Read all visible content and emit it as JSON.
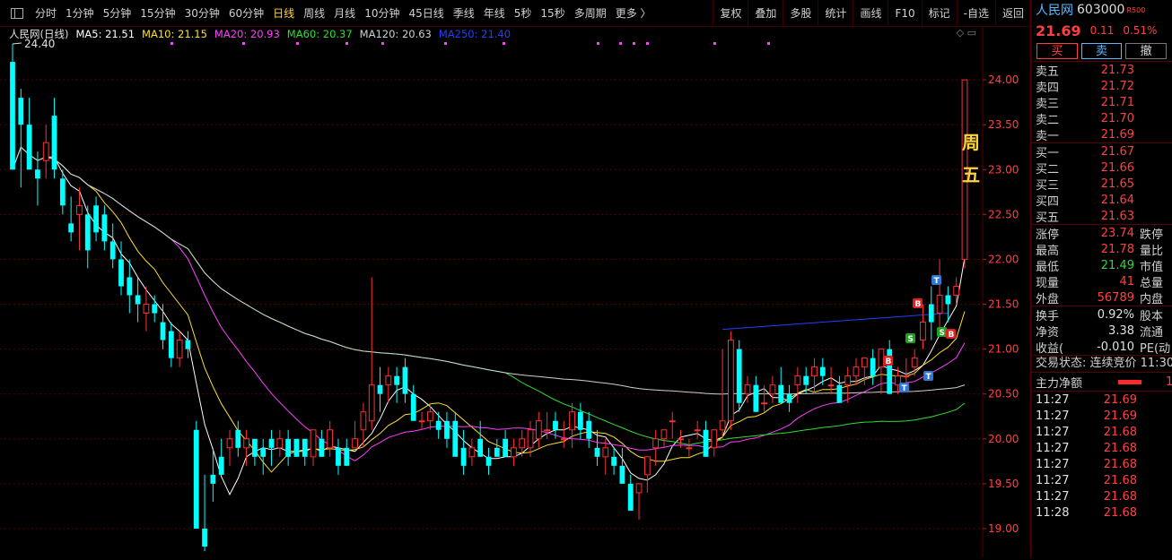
{
  "toolbar": {
    "periods": [
      "分时",
      "1分钟",
      "5分钟",
      "15分钟",
      "30分钟",
      "60分钟",
      "日线",
      "周线",
      "月线",
      "10分钟",
      "45日线",
      "季线",
      "年线",
      "5秒",
      "15秒",
      "多周期",
      "更多 〉"
    ],
    "active_period": "日线",
    "tools": [
      "复权",
      "叠加",
      "多股",
      "统计",
      "画线",
      "F10",
      "标记",
      "-自选",
      "返回"
    ]
  },
  "chart": {
    "series_name": "人民网(日线)",
    "ma": [
      {
        "label": "MA5: 21.51",
        "color": "#ffffff"
      },
      {
        "label": "MA10: 21.15",
        "color": "#ffe030"
      },
      {
        "label": "MA20: 20.93",
        "color": "#ff40ff"
      },
      {
        "label": "MA60: 20.37",
        "color": "#30e030"
      },
      {
        "label": "MA120: 20.63",
        "color": "#d0d0d0"
      },
      {
        "label": "MA250: 21.40",
        "color": "#2040ff"
      }
    ],
    "high_label": "24.40",
    "annotation": [
      "周",
      "五"
    ],
    "y_ticks": [
      "24.00",
      "23.50",
      "23.00",
      "22.50",
      "22.00",
      "21.50",
      "21.00",
      "20.50",
      "20.00",
      "19.50",
      "19.00"
    ],
    "signals": [
      "B",
      "B",
      "S",
      "S",
      "B",
      "T",
      "T",
      "T"
    ],
    "colors": {
      "up": "#ff3030",
      "down": "#00ffff"
    }
  },
  "chart_data": {
    "type": "candlestick",
    "ylim": [
      18.75,
      24.45
    ],
    "ohlc": [
      [
        24.2,
        24.4,
        23.0,
        23.0
      ],
      [
        23.8,
        23.9,
        22.8,
        23.5
      ],
      [
        23.5,
        23.8,
        23.0,
        23.0
      ],
      [
        23.0,
        23.2,
        22.6,
        22.9
      ],
      [
        23.1,
        23.5,
        22.9,
        23.3
      ],
      [
        23.6,
        23.8,
        22.9,
        23.0
      ],
      [
        22.9,
        23.0,
        22.5,
        22.6
      ],
      [
        22.4,
        22.7,
        22.2,
        22.3
      ],
      [
        22.5,
        22.8,
        22.1,
        22.6
      ],
      [
        22.5,
        22.6,
        21.9,
        22.1
      ],
      [
        22.6,
        22.7,
        22.2,
        22.3
      ],
      [
        22.5,
        22.6,
        22.1,
        22.2
      ],
      [
        22.2,
        22.4,
        21.9,
        22.0
      ],
      [
        22.0,
        22.2,
        21.6,
        21.7
      ],
      [
        21.8,
        22.0,
        21.4,
        21.6
      ],
      [
        21.6,
        21.8,
        21.3,
        21.5
      ],
      [
        21.4,
        21.7,
        21.2,
        21.5
      ],
      [
        21.5,
        21.6,
        21.3,
        21.4
      ],
      [
        21.3,
        21.5,
        21.0,
        21.1
      ],
      [
        21.2,
        21.3,
        20.8,
        20.9
      ],
      [
        20.9,
        21.2,
        20.8,
        21.1
      ],
      [
        21.1,
        21.2,
        20.9,
        21.0
      ],
      [
        20.1,
        20.2,
        19.0,
        19.0
      ],
      [
        19.0,
        19.6,
        18.75,
        18.8
      ],
      [
        19.6,
        19.9,
        19.3,
        19.5
      ],
      [
        19.8,
        20.0,
        19.6,
        19.6
      ],
      [
        19.9,
        20.1,
        19.7,
        20.0
      ],
      [
        20.1,
        20.2,
        19.8,
        19.9
      ],
      [
        19.9,
        20.1,
        19.7,
        20.0
      ],
      [
        20.0,
        20.0,
        19.7,
        19.8
      ],
      [
        19.9,
        20.0,
        19.6,
        19.8
      ],
      [
        20.0,
        20.1,
        19.7,
        19.9
      ],
      [
        19.9,
        20.1,
        19.8,
        20.0
      ],
      [
        20.0,
        20.1,
        19.7,
        19.8
      ],
      [
        20.0,
        20.0,
        19.8,
        19.8
      ],
      [
        20.0,
        20.0,
        19.7,
        19.8
      ],
      [
        19.8,
        20.1,
        19.7,
        20.1
      ],
      [
        20.0,
        20.1,
        19.8,
        19.8
      ],
      [
        19.9,
        20.2,
        19.8,
        20.1
      ],
      [
        19.9,
        20.0,
        19.6,
        19.7
      ],
      [
        19.9,
        20.0,
        19.7,
        19.7
      ],
      [
        19.9,
        20.2,
        19.9,
        20.0
      ],
      [
        20.1,
        20.4,
        19.9,
        20.3
      ],
      [
        20.2,
        21.8,
        20.1,
        20.6
      ],
      [
        20.6,
        20.8,
        20.3,
        20.5
      ],
      [
        20.6,
        20.8,
        20.4,
        20.7
      ],
      [
        20.7,
        20.8,
        20.4,
        20.6
      ],
      [
        20.8,
        20.9,
        20.4,
        20.5
      ],
      [
        20.5,
        20.6,
        20.2,
        20.2
      ],
      [
        20.2,
        20.3,
        20.1,
        20.2
      ],
      [
        20.2,
        20.4,
        20.1,
        20.3
      ],
      [
        20.2,
        20.3,
        20.0,
        20.1
      ],
      [
        20.2,
        20.3,
        19.9,
        20.0
      ],
      [
        20.2,
        20.3,
        19.9,
        19.8
      ],
      [
        19.9,
        20.1,
        19.6,
        19.7
      ],
      [
        19.8,
        20.0,
        19.7,
        19.9
      ],
      [
        20.0,
        20.2,
        19.8,
        19.8
      ],
      [
        19.8,
        19.9,
        19.6,
        19.7
      ],
      [
        19.9,
        20.0,
        19.8,
        19.8
      ],
      [
        20.0,
        20.1,
        19.8,
        19.8
      ],
      [
        19.8,
        20.0,
        19.7,
        19.9
      ],
      [
        19.9,
        20.1,
        19.8,
        20.0
      ],
      [
        19.9,
        20.2,
        19.8,
        20.1
      ],
      [
        20.0,
        20.3,
        19.9,
        20.2
      ],
      [
        20.1,
        20.3,
        20.0,
        20.1
      ],
      [
        20.2,
        20.3,
        20.0,
        20.1
      ],
      [
        20.0,
        20.2,
        19.9,
        20.0
      ],
      [
        20.1,
        20.4,
        19.9,
        20.3
      ],
      [
        20.3,
        20.4,
        20.0,
        20.1
      ],
      [
        20.2,
        20.3,
        19.9,
        20.0
      ],
      [
        19.9,
        20.1,
        19.7,
        19.8
      ],
      [
        19.8,
        20.0,
        19.6,
        19.9
      ],
      [
        19.8,
        19.9,
        19.6,
        19.7
      ],
      [
        19.7,
        19.9,
        19.5,
        19.5
      ],
      [
        19.5,
        19.6,
        19.2,
        19.2
      ],
      [
        19.4,
        19.5,
        19.1,
        19.5
      ],
      [
        19.6,
        19.8,
        19.4,
        19.8
      ],
      [
        19.9,
        20.1,
        19.7,
        20.0
      ],
      [
        20.0,
        20.1,
        19.9,
        20.1
      ],
      [
        20.2,
        20.3,
        20.0,
        20.2
      ],
      [
        20.0,
        20.1,
        19.9,
        20.0
      ],
      [
        19.9,
        20.0,
        19.8,
        19.9
      ],
      [
        20.1,
        20.2,
        20.0,
        20.1
      ],
      [
        20.1,
        20.2,
        19.8,
        19.8
      ],
      [
        19.9,
        20.1,
        19.8,
        20.1
      ],
      [
        20.1,
        21.0,
        20.0,
        20.2
      ],
      [
        20.2,
        21.2,
        20.1,
        21.1
      ],
      [
        21.0,
        21.1,
        20.3,
        20.4
      ],
      [
        20.5,
        20.7,
        20.4,
        20.6
      ],
      [
        20.6,
        20.7,
        20.3,
        20.3
      ],
      [
        20.4,
        20.6,
        20.3,
        20.4
      ],
      [
        20.5,
        20.7,
        20.4,
        20.6
      ],
      [
        20.6,
        20.8,
        20.4,
        20.4
      ],
      [
        20.5,
        20.6,
        20.3,
        20.4
      ],
      [
        20.6,
        20.8,
        20.4,
        20.7
      ],
      [
        20.7,
        20.8,
        20.5,
        20.6
      ],
      [
        20.7,
        20.9,
        20.5,
        20.8
      ],
      [
        20.8,
        20.9,
        20.6,
        20.7
      ],
      [
        20.6,
        20.8,
        20.5,
        20.6
      ],
      [
        20.6,
        20.7,
        20.4,
        20.4
      ],
      [
        20.6,
        20.8,
        20.4,
        20.7
      ],
      [
        20.7,
        20.9,
        20.6,
        20.8
      ],
      [
        20.8,
        20.9,
        20.6,
        20.9
      ],
      [
        20.9,
        21.0,
        20.6,
        20.7
      ],
      [
        20.8,
        21.0,
        20.5,
        21.0
      ],
      [
        21.0,
        21.1,
        20.5,
        20.5
      ],
      [
        20.6,
        20.8,
        20.5,
        20.7
      ],
      [
        20.7,
        20.9,
        20.6,
        20.7
      ],
      [
        20.8,
        21.0,
        20.7,
        20.9
      ],
      [
        21.1,
        21.5,
        21.0,
        21.3
      ],
      [
        21.5,
        21.7,
        21.1,
        21.3
      ],
      [
        21.4,
        22.0,
        21.2,
        21.6
      ],
      [
        21.6,
        21.7,
        21.3,
        21.5
      ],
      [
        21.6,
        21.8,
        21.5,
        21.7
      ],
      [
        22.0,
        24.0,
        21.9,
        24.0
      ]
    ]
  },
  "quote": {
    "name": "人民网",
    "code": "603000",
    "tag": "R500",
    "price": "21.69",
    "change": "0.11",
    "pct": "0.51%",
    "buttons": {
      "buy": "买",
      "sell": "卖",
      "cancel": "撤"
    },
    "sell_book": [
      {
        "label": "卖五",
        "price": "21.73"
      },
      {
        "label": "卖四",
        "price": "21.72"
      },
      {
        "label": "卖三",
        "price": "21.71"
      },
      {
        "label": "卖二",
        "price": "21.70"
      },
      {
        "label": "卖一",
        "price": "21.69"
      }
    ],
    "buy_book": [
      {
        "label": "买一",
        "price": "21.67"
      },
      {
        "label": "买二",
        "price": "21.66"
      },
      {
        "label": "买三",
        "price": "21.65"
      },
      {
        "label": "买四",
        "price": "21.64"
      },
      {
        "label": "买五",
        "price": "21.63"
      }
    ],
    "stats": [
      {
        "label": "涨停",
        "value": "23.74",
        "label2": "跌停",
        "color": "#ff4040"
      },
      {
        "label": "最高",
        "value": "21.78",
        "label2": "量比",
        "color": "#ff4040"
      },
      {
        "label": "最低",
        "value": "21.49",
        "label2": "市值",
        "color": "#3ad23a"
      },
      {
        "label": "现量",
        "value": "41",
        "label2": "总量",
        "color": "#ff4040"
      },
      {
        "label": "外盘",
        "value": "56789",
        "label2": "内盘",
        "color": "#ff4040"
      }
    ],
    "stats2": [
      {
        "label": "换手",
        "value": "0.92%",
        "label2": "股本"
      },
      {
        "label": "净资",
        "value": "3.38",
        "label2": "流通"
      },
      {
        "label": "收益(",
        "value": "-0.010",
        "label2": "PE(动"
      }
    ],
    "status": "交易状态: 连续竞价 11:30",
    "flow_label": "主力净额",
    "flow_value": "1",
    "ticks": [
      {
        "time": "11:27",
        "price": "21.69"
      },
      {
        "time": "11:27",
        "price": "21.69"
      },
      {
        "time": "11:27",
        "price": "21.68"
      },
      {
        "time": "11:27",
        "price": "21.68"
      },
      {
        "time": "11:27",
        "price": "21.68"
      },
      {
        "time": "11:27",
        "price": "21.68"
      },
      {
        "time": "11:27",
        "price": "21.68"
      },
      {
        "time": "11:28",
        "price": "21.68"
      }
    ]
  }
}
